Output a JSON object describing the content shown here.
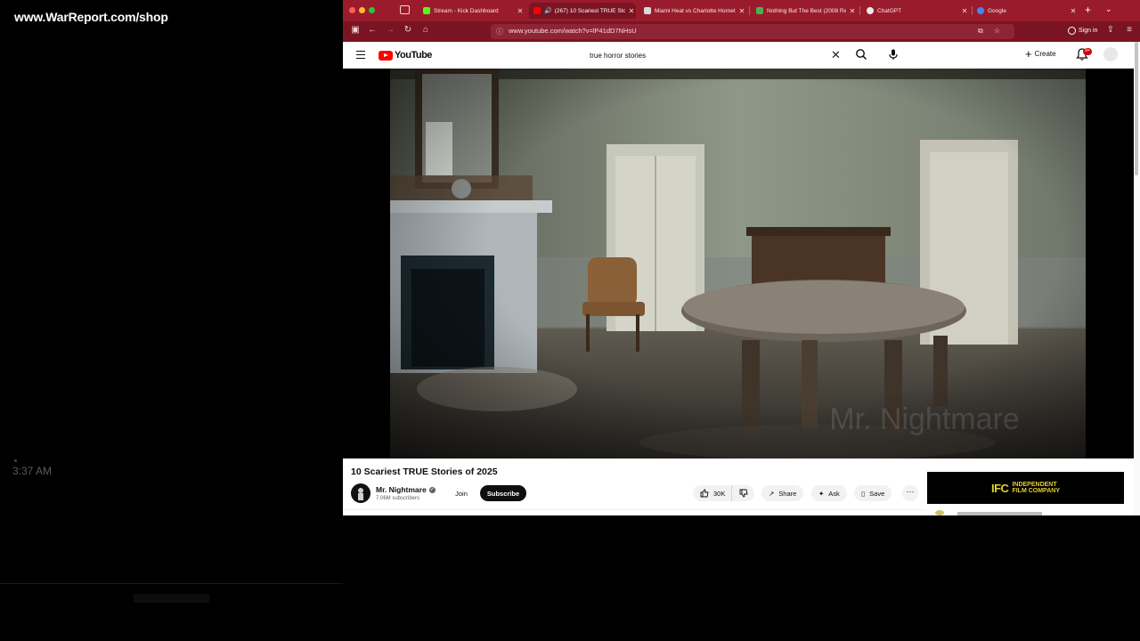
{
  "overlay": {
    "url": "www.WarReport.com/shop",
    "time": "3:37 AM"
  },
  "browser": {
    "tabs": [
      {
        "label": "Stream - Kick Dashboard",
        "favicon_color": "#53fc18",
        "active": false
      },
      {
        "label": "(267) 10 Scariest TRUE Sto",
        "favicon_color": "#ff0000",
        "active": true,
        "audio": true
      },
      {
        "label": "Miami Heat vs Charlotte Hornet",
        "favicon_color": "#d9d9d9",
        "active": false
      },
      {
        "label": "Nothing But The Best (2008 Re",
        "favicon_color": "#4caf50",
        "active": false
      },
      {
        "label": "ChatGPT",
        "favicon_color": "#eaeaea",
        "active": false
      },
      {
        "label": "Google",
        "favicon_color": "#4285f4",
        "active": false
      }
    ],
    "address": "www.youtube.com/watch?v=lP41dD7NHsU",
    "sign_in": "Sign in"
  },
  "youtube": {
    "logo_text": "YouTube",
    "search_value": "true horror stories",
    "create_label": "Create",
    "notifications_badge": "9+",
    "video": {
      "title": "10 Scariest TRUE Stories of 2025",
      "watermark": "Mr. Nightmare"
    },
    "channel": {
      "name": "Mr. Nightmare",
      "subscribers": "7.06M subscribers"
    },
    "buttons": {
      "join": "Join",
      "subscribe": "Subscribe",
      "likes": "30K",
      "share": "Share",
      "ask": "Ask",
      "save": "Save"
    },
    "ad": {
      "logo": "IFC",
      "line1": "INDEPENDENT",
      "line2": "FILM COMPANY"
    }
  },
  "colors": {
    "tab_bar": "#9a1c2c",
    "toolbar": "#7a1422",
    "youtube_red": "#ff0000",
    "ad_yellow": "#e3cf2f"
  }
}
